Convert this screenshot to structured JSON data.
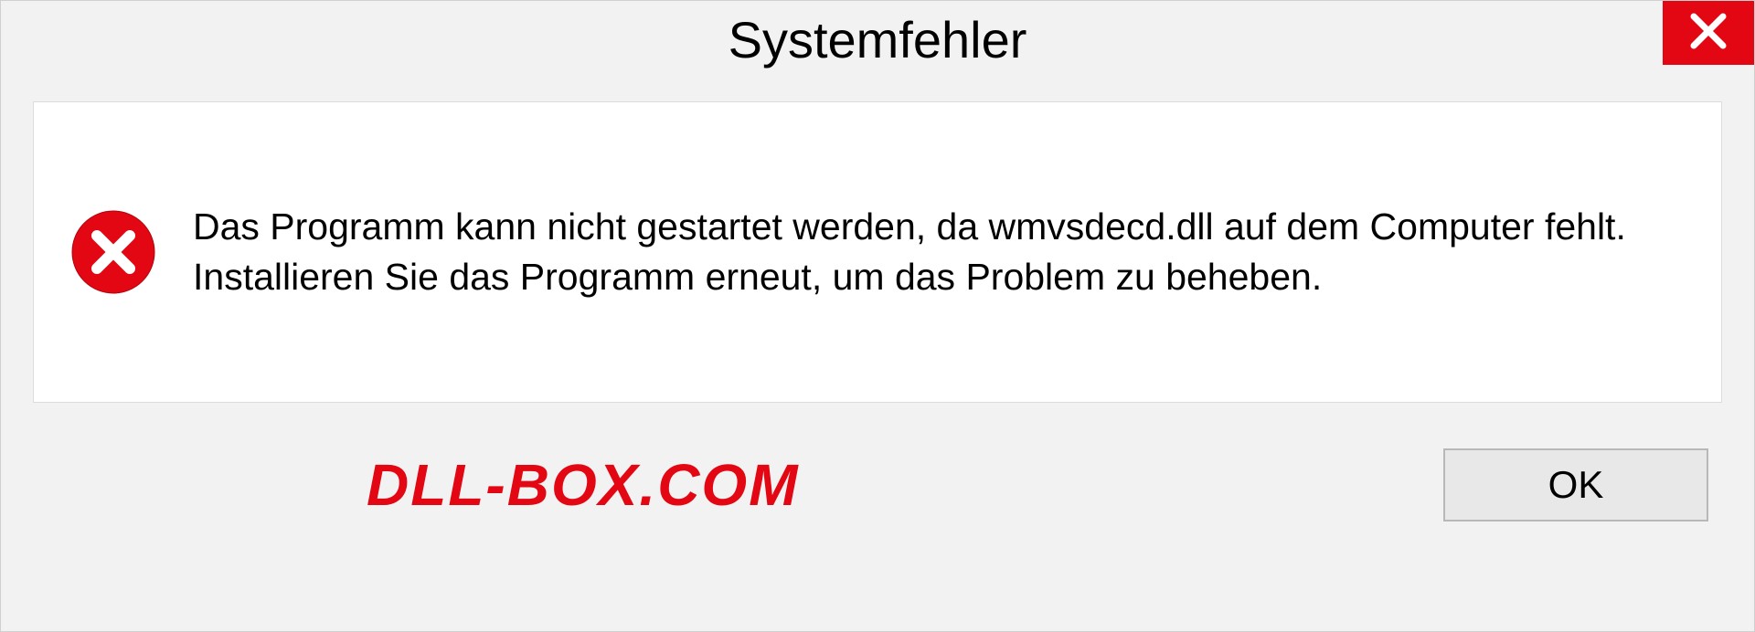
{
  "dialog": {
    "title": "Systemfehler",
    "message": "Das Programm kann nicht gestartet werden, da wmvsdecd.dll auf dem Computer fehlt. Installieren Sie das Programm erneut, um das Problem zu beheben.",
    "ok_button": "OK"
  },
  "watermark": "DLL-BOX.COM",
  "colors": {
    "accent_red": "#e20712"
  }
}
